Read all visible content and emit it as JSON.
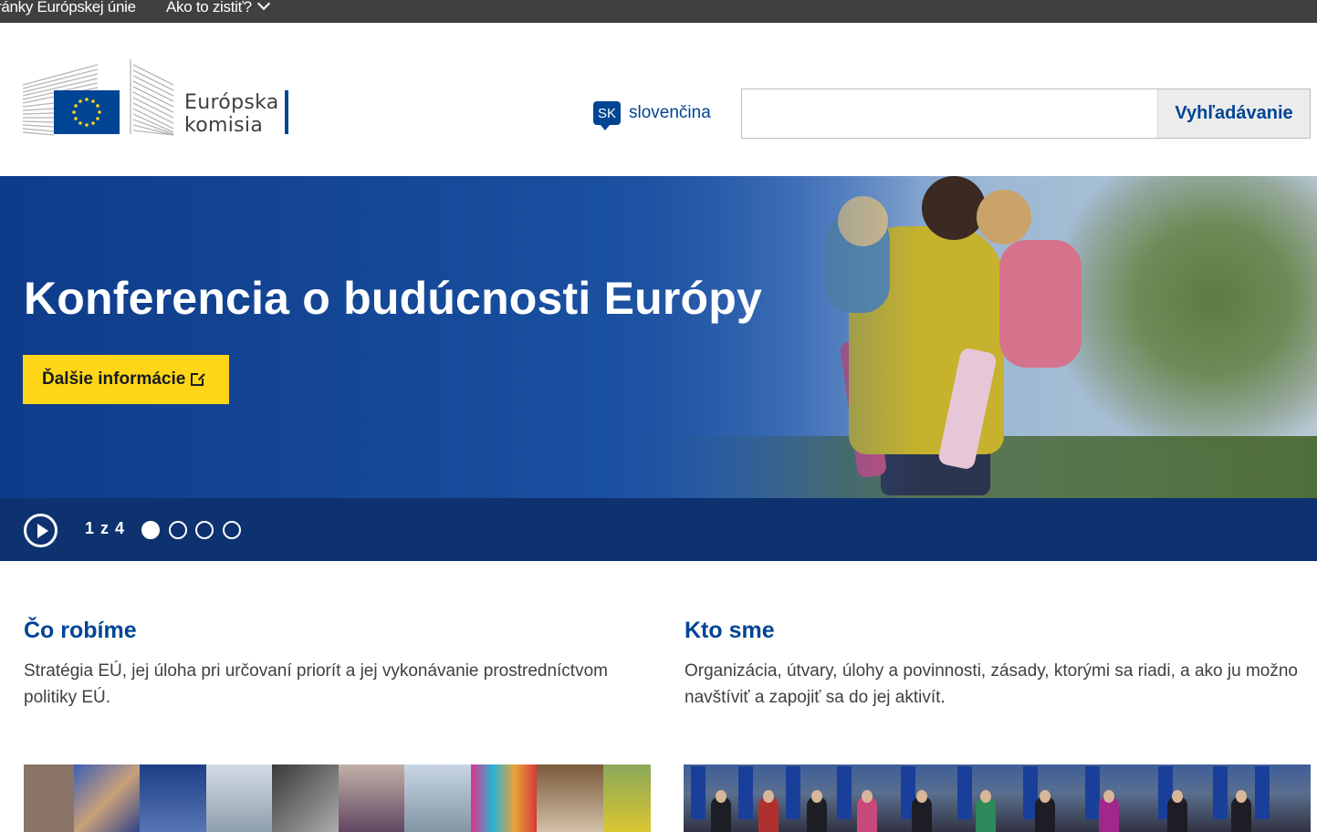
{
  "topbar": {
    "eu_link": "ránky Európskej únie",
    "how_to_check": "Ako to zistiť?"
  },
  "header": {
    "logo_line1": "Európska",
    "logo_line2": "komisia",
    "language_code": "SK",
    "language_label": "slovenčina",
    "search_placeholder": "",
    "search_button": "Vyhľadávanie"
  },
  "hero": {
    "title": "Konferencia o budúcnosti Európy",
    "cta_label": "Ďalšie informácie",
    "slide_counter": "1 z 4",
    "slides_total": 4,
    "active_slide": 1
  },
  "sections": [
    {
      "title": "Čo robíme",
      "description": "Stratégia EÚ, jej úloha pri určovaní priorít a jej vykonávanie prostredníctvom politiky EÚ."
    },
    {
      "title": "Kto sme",
      "description": "Organizácia, útvary, úlohy a povinnosti, zásady, ktorými sa riadi, a ako ju možno navštíviť a zapojiť sa do jej aktivít."
    }
  ],
  "colors": {
    "eu_blue": "#004494",
    "topbar": "#404040",
    "cta_yellow": "#ffd617",
    "carousel_bar": "#0e3270"
  },
  "icons": [
    "chevron-down-icon",
    "eu-flag-icon",
    "language-bubble-icon",
    "external-link-icon",
    "play-icon"
  ]
}
